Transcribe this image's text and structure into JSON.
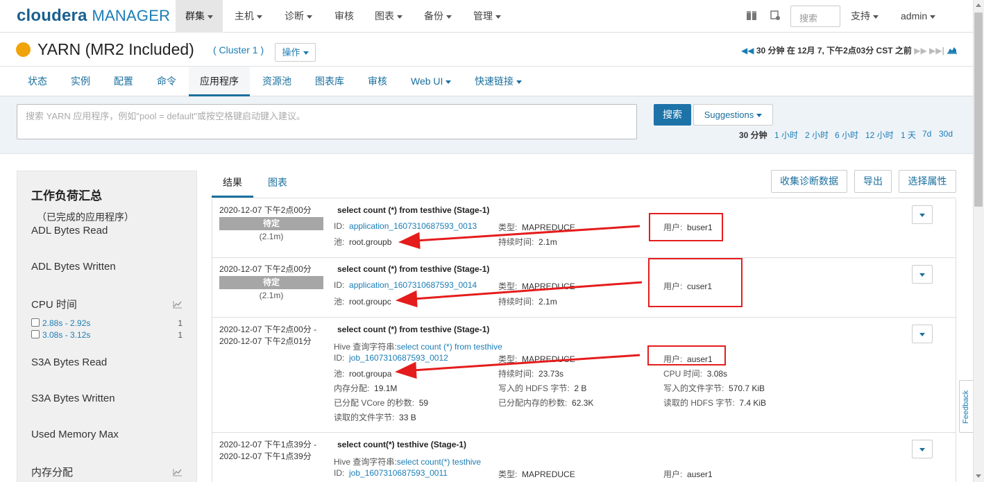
{
  "topnav": {
    "logo_main": "cloudera",
    "logo_sub": "MANAGER",
    "items": [
      "群集",
      "主机",
      "诊断",
      "审核",
      "图表",
      "备份",
      "管理"
    ],
    "search_placeholder": "搜索",
    "support": "支持",
    "user": "admin"
  },
  "service": {
    "title": "YARN (MR2 Included)",
    "cluster": "( Cluster 1 )",
    "ops": "操作",
    "time_info": "30 分钟 在 12月 7, 下午2点03分 CST 之前",
    "status_color": "#f0a30a"
  },
  "tabs": [
    "状态",
    "实例",
    "配置",
    "命令",
    "应用程序",
    "资源池",
    "图表库",
    "审核",
    "Web UI",
    "快速链接"
  ],
  "search": {
    "placeholder": "搜索 YARN 应用程序，例如\"pool = default\"或按空格键启动键入建议。",
    "button": "搜索",
    "suggestions": "Suggestions",
    "ranges": [
      "30 分钟",
      "1 小时",
      "2 小时",
      "6 小时",
      "12 小时",
      "1 天",
      "7d",
      "30d"
    ]
  },
  "sidebar": {
    "title": "工作负荷汇总",
    "subtitle": "（已完成的应用程序）",
    "items": [
      "ADL Bytes Read",
      "ADL Bytes Written",
      "CPU 时间",
      "S3A Bytes Read",
      "S3A Bytes Written",
      "Used Memory Max",
      "内存分配"
    ],
    "cpu_ranges": [
      {
        "label": "2.88s - 2.92s",
        "count": "1"
      },
      {
        "label": "3.08s - 3.12s",
        "count": "1"
      }
    ]
  },
  "results": {
    "tab_results": "结果",
    "tab_charts": "图表",
    "btn_collect": "收集诊断数据",
    "btn_export": "导出",
    "btn_select": "选择属性",
    "rows": [
      {
        "time1": "2020-12-07 下午2点00分",
        "time2": "",
        "status": "待定",
        "duration": "(2.1m)",
        "query": "select count (*) from testhive (Stage-1)",
        "hive": "",
        "id": "application_1607310687593_0013",
        "type": "MAPREDUCE",
        "user": "buser1",
        "pool": "root.groupb",
        "dur": "2.1m"
      },
      {
        "time1": "2020-12-07 下午2点00分",
        "time2": "",
        "status": "待定",
        "duration": "(2.1m)",
        "query": "select count (*) from testhive (Stage-1)",
        "hive": "",
        "id": "application_1607310687593_0014",
        "type": "MAPREDUCE",
        "user": "cuser1",
        "pool": "root.groupc",
        "dur": "2.1m"
      },
      {
        "time1": "2020-12-07 下午2点00分 -",
        "time2": "2020-12-07 下午2点01分",
        "query": "select count (*) from testhive (Stage-1)",
        "hive": "select count (*) from testhive",
        "id": "job_1607310687593_0012",
        "type": "MAPREDUCE",
        "user": "auser1",
        "pool": "root.groupa",
        "dur": "23.73s",
        "cpu": "3.08s",
        "mem": "19.1M",
        "hdfs_write": "2 B",
        "file_write": "570.7 KiB",
        "vcore": "59",
        "mem_sec": "62.3K",
        "hdfs_read": "7.4 KiB",
        "file_read": "33 B"
      },
      {
        "time1": "2020-12-07 下午1点39分 -",
        "time2": "2020-12-07 下午1点39分",
        "query": "select count(*) testhive (Stage-1)",
        "hive": "select count(*) testhive",
        "id": "job_1607310687593_0011",
        "type": "MAPREDUCE",
        "user": "auser1"
      }
    ]
  },
  "labels": {
    "id": "ID:",
    "type": "类型:",
    "user": "用户:",
    "pool": "池:",
    "duration": "持续时间:",
    "hive_query": "Hive 查询字符串:",
    "cpu": "CPU 时间:",
    "mem": "内存分配:",
    "hdfs_write": "写入的 HDFS 字节:",
    "file_write": "写入的文件字节:",
    "vcore": "已分配 VCore 的秒数:",
    "mem_sec": "已分配内存的秒数:",
    "hdfs_read": "读取的 HDFS 字节:",
    "file_read": "读取的文件字节:"
  },
  "feedback": "Feedback",
  "annotation_color": "#e51c1c"
}
